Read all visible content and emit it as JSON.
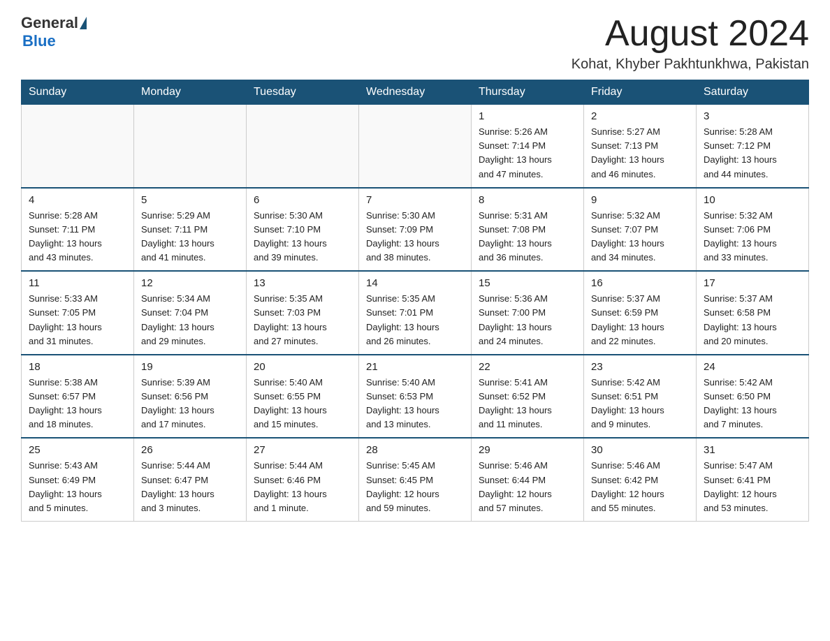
{
  "header": {
    "logo_general": "General",
    "logo_blue": "Blue",
    "month_year": "August 2024",
    "location": "Kohat, Khyber Pakhtunkhwa, Pakistan"
  },
  "weekdays": [
    "Sunday",
    "Monday",
    "Tuesday",
    "Wednesday",
    "Thursday",
    "Friday",
    "Saturday"
  ],
  "weeks": [
    [
      {
        "day": "",
        "info": ""
      },
      {
        "day": "",
        "info": ""
      },
      {
        "day": "",
        "info": ""
      },
      {
        "day": "",
        "info": ""
      },
      {
        "day": "1",
        "info": "Sunrise: 5:26 AM\nSunset: 7:14 PM\nDaylight: 13 hours\nand 47 minutes."
      },
      {
        "day": "2",
        "info": "Sunrise: 5:27 AM\nSunset: 7:13 PM\nDaylight: 13 hours\nand 46 minutes."
      },
      {
        "day": "3",
        "info": "Sunrise: 5:28 AM\nSunset: 7:12 PM\nDaylight: 13 hours\nand 44 minutes."
      }
    ],
    [
      {
        "day": "4",
        "info": "Sunrise: 5:28 AM\nSunset: 7:11 PM\nDaylight: 13 hours\nand 43 minutes."
      },
      {
        "day": "5",
        "info": "Sunrise: 5:29 AM\nSunset: 7:11 PM\nDaylight: 13 hours\nand 41 minutes."
      },
      {
        "day": "6",
        "info": "Sunrise: 5:30 AM\nSunset: 7:10 PM\nDaylight: 13 hours\nand 39 minutes."
      },
      {
        "day": "7",
        "info": "Sunrise: 5:30 AM\nSunset: 7:09 PM\nDaylight: 13 hours\nand 38 minutes."
      },
      {
        "day": "8",
        "info": "Sunrise: 5:31 AM\nSunset: 7:08 PM\nDaylight: 13 hours\nand 36 minutes."
      },
      {
        "day": "9",
        "info": "Sunrise: 5:32 AM\nSunset: 7:07 PM\nDaylight: 13 hours\nand 34 minutes."
      },
      {
        "day": "10",
        "info": "Sunrise: 5:32 AM\nSunset: 7:06 PM\nDaylight: 13 hours\nand 33 minutes."
      }
    ],
    [
      {
        "day": "11",
        "info": "Sunrise: 5:33 AM\nSunset: 7:05 PM\nDaylight: 13 hours\nand 31 minutes."
      },
      {
        "day": "12",
        "info": "Sunrise: 5:34 AM\nSunset: 7:04 PM\nDaylight: 13 hours\nand 29 minutes."
      },
      {
        "day": "13",
        "info": "Sunrise: 5:35 AM\nSunset: 7:03 PM\nDaylight: 13 hours\nand 27 minutes."
      },
      {
        "day": "14",
        "info": "Sunrise: 5:35 AM\nSunset: 7:01 PM\nDaylight: 13 hours\nand 26 minutes."
      },
      {
        "day": "15",
        "info": "Sunrise: 5:36 AM\nSunset: 7:00 PM\nDaylight: 13 hours\nand 24 minutes."
      },
      {
        "day": "16",
        "info": "Sunrise: 5:37 AM\nSunset: 6:59 PM\nDaylight: 13 hours\nand 22 minutes."
      },
      {
        "day": "17",
        "info": "Sunrise: 5:37 AM\nSunset: 6:58 PM\nDaylight: 13 hours\nand 20 minutes."
      }
    ],
    [
      {
        "day": "18",
        "info": "Sunrise: 5:38 AM\nSunset: 6:57 PM\nDaylight: 13 hours\nand 18 minutes."
      },
      {
        "day": "19",
        "info": "Sunrise: 5:39 AM\nSunset: 6:56 PM\nDaylight: 13 hours\nand 17 minutes."
      },
      {
        "day": "20",
        "info": "Sunrise: 5:40 AM\nSunset: 6:55 PM\nDaylight: 13 hours\nand 15 minutes."
      },
      {
        "day": "21",
        "info": "Sunrise: 5:40 AM\nSunset: 6:53 PM\nDaylight: 13 hours\nand 13 minutes."
      },
      {
        "day": "22",
        "info": "Sunrise: 5:41 AM\nSunset: 6:52 PM\nDaylight: 13 hours\nand 11 minutes."
      },
      {
        "day": "23",
        "info": "Sunrise: 5:42 AM\nSunset: 6:51 PM\nDaylight: 13 hours\nand 9 minutes."
      },
      {
        "day": "24",
        "info": "Sunrise: 5:42 AM\nSunset: 6:50 PM\nDaylight: 13 hours\nand 7 minutes."
      }
    ],
    [
      {
        "day": "25",
        "info": "Sunrise: 5:43 AM\nSunset: 6:49 PM\nDaylight: 13 hours\nand 5 minutes."
      },
      {
        "day": "26",
        "info": "Sunrise: 5:44 AM\nSunset: 6:47 PM\nDaylight: 13 hours\nand 3 minutes."
      },
      {
        "day": "27",
        "info": "Sunrise: 5:44 AM\nSunset: 6:46 PM\nDaylight: 13 hours\nand 1 minute."
      },
      {
        "day": "28",
        "info": "Sunrise: 5:45 AM\nSunset: 6:45 PM\nDaylight: 12 hours\nand 59 minutes."
      },
      {
        "day": "29",
        "info": "Sunrise: 5:46 AM\nSunset: 6:44 PM\nDaylight: 12 hours\nand 57 minutes."
      },
      {
        "day": "30",
        "info": "Sunrise: 5:46 AM\nSunset: 6:42 PM\nDaylight: 12 hours\nand 55 minutes."
      },
      {
        "day": "31",
        "info": "Sunrise: 5:47 AM\nSunset: 6:41 PM\nDaylight: 12 hours\nand 53 minutes."
      }
    ]
  ]
}
